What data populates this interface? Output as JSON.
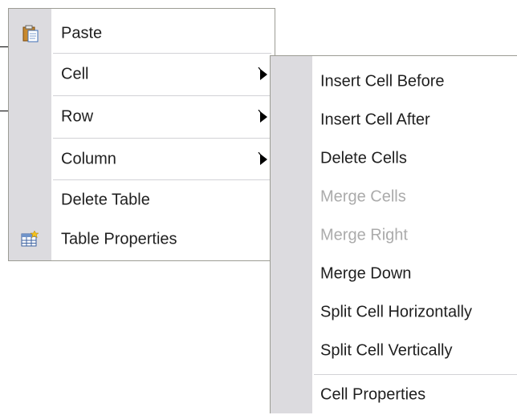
{
  "primary_menu": {
    "items": [
      {
        "label": "Paste",
        "icon": "clipboard-icon"
      },
      {
        "label": "Cell",
        "submenu": true
      },
      {
        "label": "Row",
        "submenu": true
      },
      {
        "label": "Column",
        "submenu": true
      },
      {
        "label": "Delete Table"
      },
      {
        "label": "Table Properties",
        "icon": "table-properties-icon"
      }
    ]
  },
  "cell_submenu": {
    "items": [
      {
        "label": "Insert Cell Before",
        "enabled": true
      },
      {
        "label": "Insert Cell After",
        "enabled": true
      },
      {
        "label": "Delete Cells",
        "enabled": true
      },
      {
        "label": "Merge Cells",
        "enabled": false
      },
      {
        "label": "Merge Right",
        "enabled": false
      },
      {
        "label": "Merge Down",
        "enabled": true
      },
      {
        "label": "Split Cell Horizontally",
        "enabled": true
      },
      {
        "label": "Split Cell Vertically",
        "enabled": true
      },
      {
        "label": "Cell Properties",
        "enabled": true
      }
    ]
  },
  "colors": {
    "gutter": "#dcdbdf",
    "border": "#9c9c94",
    "disabled_text": "#ababab"
  }
}
